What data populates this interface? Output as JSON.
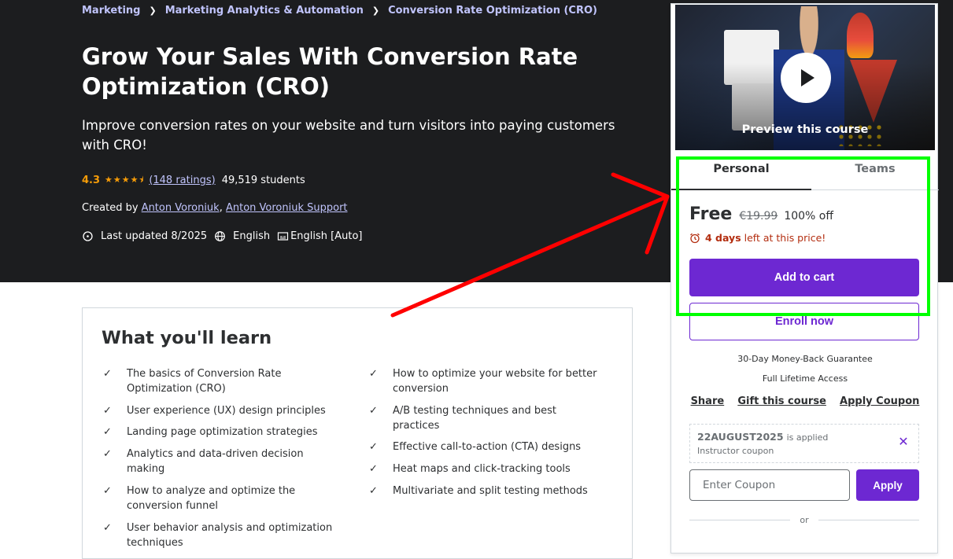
{
  "breadcrumb": [
    "Marketing",
    "Marketing Analytics & Automation",
    "Conversion Rate Optimization (CRO)"
  ],
  "course": {
    "title": "Grow Your Sales With Conversion Rate Optimization (CRO)",
    "subtitle": "Improve conversion rates on your website and turn visitors into paying customers with CRO!",
    "rating": "4.3",
    "ratings_link": "(148 ratings)",
    "students": "49,519 students",
    "created_prefix": "Created by",
    "instructor_1": "Anton Voroniuk",
    "instructor_sep": ",",
    "instructor_2": "Anton Voroniuk Support",
    "last_updated": "Last updated 8/2025",
    "language": "English",
    "captions": "English [Auto]"
  },
  "sidebar": {
    "preview_label": "Preview this course",
    "tabs": [
      "Personal",
      "Teams"
    ],
    "price": "Free",
    "original_price": "€19.99",
    "discount": "100% off",
    "timer_days": "4 days",
    "timer_suffix": "left at this price!",
    "add_to_cart": "Add to cart",
    "enroll_now": "Enroll now",
    "guarantee": "30-Day Money-Back Guarantee",
    "lifetime": "Full Lifetime Access",
    "links": [
      "Share",
      "Gift this course",
      "Apply Coupon"
    ],
    "coupon_code": "22AUGUST2025",
    "coupon_applied": "is applied",
    "coupon_type": "Instructor coupon",
    "coupon_placeholder": "Enter Coupon",
    "apply": "Apply",
    "or": "or"
  },
  "learn": {
    "title": "What you'll learn",
    "left": [
      "The basics of Conversion Rate Optimization (CRO)",
      "User experience (UX) design principles",
      "Landing page optimization strategies",
      "Analytics and data-driven decision making",
      "How to analyze and optimize the conversion funnel",
      "User behavior analysis and optimization techniques"
    ],
    "right": [
      "How to optimize your website for better conversion",
      "A/B testing techniques and best practices",
      "Effective call-to-action (CTA) designs",
      "Heat maps and click-tracking tools",
      "Multivariate and split testing methods"
    ]
  },
  "colors": {
    "hero_bg": "#1c1d1f",
    "link": "#c0c4fc",
    "star": "#f69c08",
    "primary": "#6d28d2",
    "timer": "#b32d0f",
    "annotation_box": "#00ff00",
    "annotation_arrow": "#ff0000"
  }
}
